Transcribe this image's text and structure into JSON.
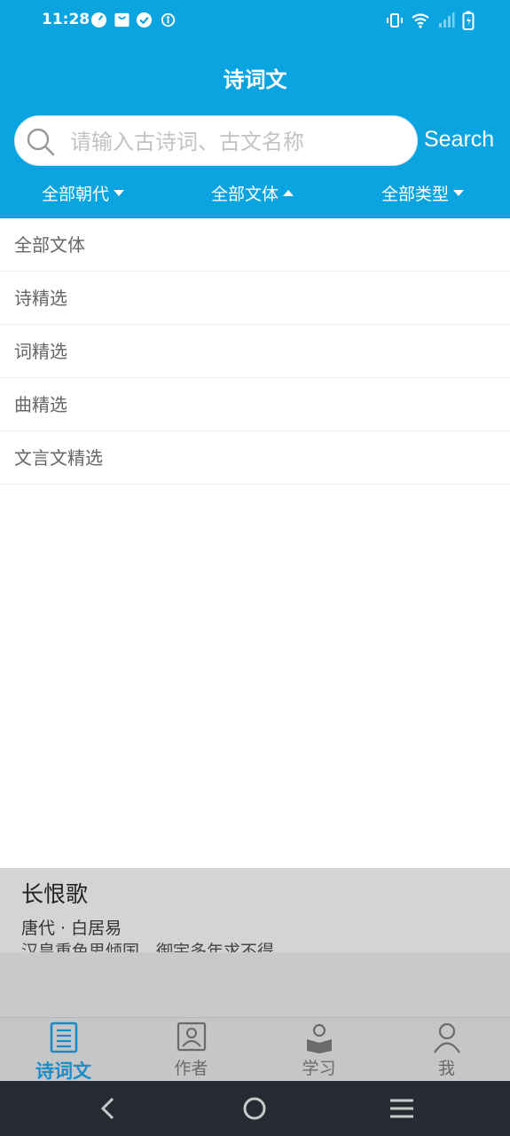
{
  "status_bar": {
    "time": "11:28"
  },
  "header": {
    "title": "诗词文",
    "search": {
      "placeholder": "请输入古诗词、古文名称",
      "button_label": "Search"
    },
    "filters": [
      {
        "label": "全部朝代",
        "state": "collapsed"
      },
      {
        "label": "全部文体",
        "state": "expanded"
      },
      {
        "label": "全部类型",
        "state": "collapsed"
      }
    ]
  },
  "dropdown": {
    "items": [
      "全部文体",
      "诗精选",
      "词精选",
      "曲精选",
      "文言文精选"
    ]
  },
  "poem_preview": {
    "title": "长恨歌",
    "meta": "唐代 · 白居易",
    "first_line": "汉皇重色思倾国，御宇多年求不得。"
  },
  "tabs": [
    {
      "label": "诗词文",
      "icon": "document-icon",
      "active": true
    },
    {
      "label": "作者",
      "icon": "author-icon",
      "active": false
    },
    {
      "label": "学习",
      "icon": "study-icon",
      "active": false
    },
    {
      "label": "我",
      "icon": "profile-icon",
      "active": false
    }
  ],
  "colors": {
    "primary": "#0aa4e0",
    "active_tab": "#1a8cc7",
    "navbar": "#262a33"
  }
}
